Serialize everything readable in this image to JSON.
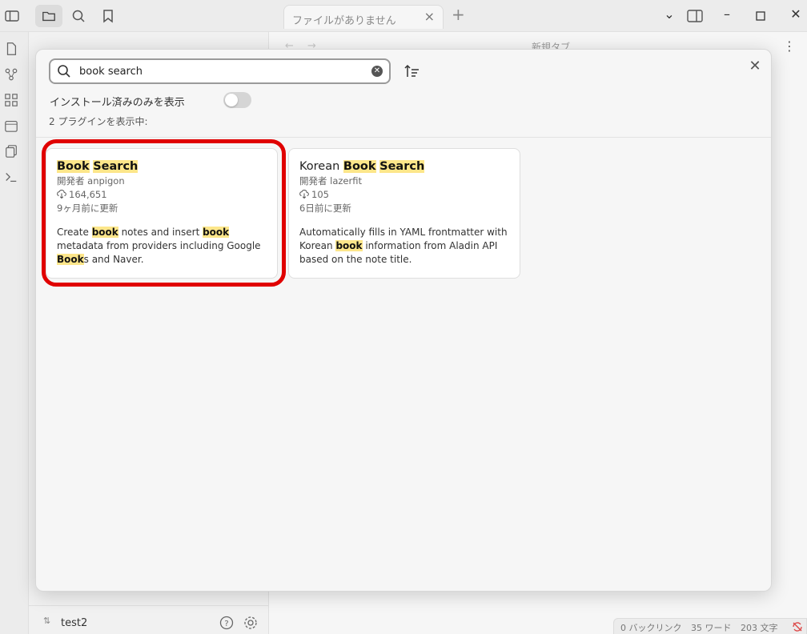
{
  "window": {
    "tab_title": "ファイルがありません",
    "nav_title": "新規タブ"
  },
  "vault": {
    "name": "test2"
  },
  "status_bar": {
    "backlinks": "0 バックリンク",
    "words": "35 ワード",
    "chars": "203 文字"
  },
  "modal": {
    "search_value": "book search",
    "filter_label": "インストール済みのみを表示",
    "installed_only": false,
    "count_label": "2 プラグインを表示中:"
  },
  "plugins": [
    {
      "title_parts": [
        "Book",
        " ",
        "Search"
      ],
      "author": "開発者 anpigon",
      "downloads": "164,651",
      "updated": "9ヶ月前に更新",
      "desc_parts": [
        "Create ",
        "book",
        " notes and insert ",
        "book",
        " metadata from providers including Google ",
        "Book",
        "s and Naver."
      ]
    },
    {
      "title_parts": [
        "Korean ",
        "Book",
        " ",
        "Search"
      ],
      "author": "開発者 lazerfit",
      "downloads": "105",
      "updated": "6日前に更新",
      "desc_parts": [
        "Automatically fills in YAML frontmatter with Korean ",
        "book",
        " information from Aladin API based on the note title."
      ]
    }
  ],
  "colors": {
    "highlight": "#fde68a",
    "annotation_ring": "#e00000"
  }
}
